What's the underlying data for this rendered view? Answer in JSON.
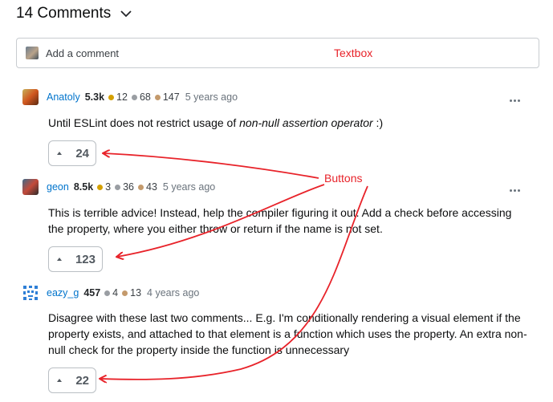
{
  "header": {
    "title": "14 Comments"
  },
  "comment_box": {
    "placeholder": "Add a comment"
  },
  "annotations": {
    "textbox": "Textbox",
    "buttons": "Buttons"
  },
  "comments": [
    {
      "username": "Anatoly",
      "reputation": "5.3k",
      "gold": "12",
      "silver": "68",
      "bronze": "147",
      "time": "5 years ago",
      "text_before": "Until ESLint does not restrict usage of ",
      "text_italic": "non-null assertion operator",
      "text_after": " :)",
      "votes": "24"
    },
    {
      "username": "geon",
      "reputation": "8.5k",
      "gold": "3",
      "silver": "36",
      "bronze": "43",
      "time": "5 years ago",
      "text": "This is terrible advice! Instead, help the compiler figuring it out. Add a check before accessing the property, where you either throw or return if the name is not set.",
      "votes": "123"
    },
    {
      "username": "eazy_g",
      "reputation": "457",
      "silver": "4",
      "bronze": "13",
      "time": "4 years ago",
      "text": "Disagree with these last two comments... E.g. I'm conditionally rendering a visual element if the property exists, and attached to that element is a function which uses the property. An extra non-null check for the property inside the function is unnecessary",
      "votes": "22"
    }
  ],
  "colors": {
    "link": "#0074cc",
    "gold_badge": "#d4a000",
    "silver_badge": "#9a9ea3",
    "bronze_badge": "#c49a6c",
    "annotation_red": "#e8232a"
  }
}
